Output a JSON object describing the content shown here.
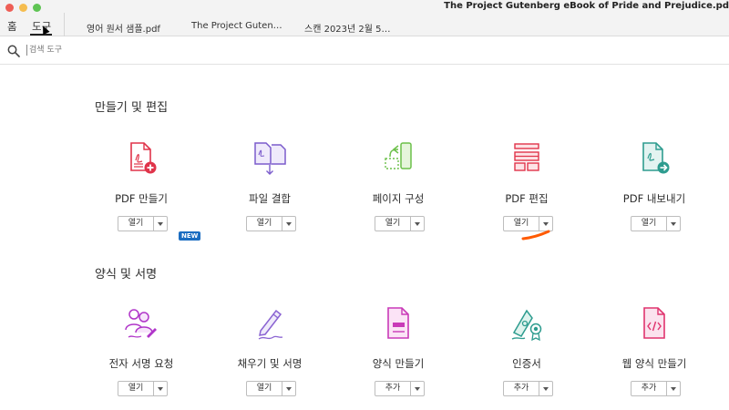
{
  "window": {
    "title": "The Project Gutenberg eBook of Pride and Prejudice.pd"
  },
  "tabs": {
    "home": "홈",
    "tools": "도구"
  },
  "doc_tabs": [
    "영어 원서 샘플.pdf",
    "The Project Guten…",
    "스캔 2023년 2월 5…"
  ],
  "search": {
    "placeholder": "검색 도구"
  },
  "sections": [
    {
      "title": "만들기 및 편집",
      "tools": [
        {
          "label": "PDF 만들기",
          "button": "열기",
          "icon": "create-pdf-icon"
        },
        {
          "label": "파일 결합",
          "button": "열기",
          "icon": "combine-files-icon"
        },
        {
          "label": "페이지 구성",
          "button": "열기",
          "icon": "organize-pages-icon"
        },
        {
          "label": "PDF 편집",
          "button": "열기",
          "icon": "edit-pdf-icon"
        },
        {
          "label": "PDF 내보내기",
          "button": "열기",
          "icon": "export-pdf-icon"
        }
      ]
    },
    {
      "title": "양식 및 서명",
      "badge": "NEW",
      "tools": [
        {
          "label": "전자 서명 요청",
          "button": "열기",
          "icon": "request-signatures-icon"
        },
        {
          "label": "채우기 및 서명",
          "button": "열기",
          "icon": "fill-sign-icon"
        },
        {
          "label": "양식 만들기",
          "button": "추가",
          "icon": "prepare-form-icon"
        },
        {
          "label": "인증서",
          "button": "추가",
          "icon": "certificates-icon"
        },
        {
          "label": "웹 양식 만들기",
          "button": "추가",
          "icon": "web-form-icon"
        }
      ]
    }
  ],
  "colors": {
    "create": "#e0344a",
    "combine": "#7b5ccc",
    "organize": "#6cc04a",
    "edit": "#e0344a",
    "export": "#2e9c8f",
    "sign": "#b035c9",
    "badge": "#1b6dc1",
    "annotation": "#ff5a00"
  }
}
